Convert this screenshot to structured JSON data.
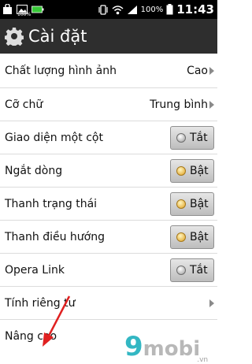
{
  "status_bar": {
    "battery_percent": "100%",
    "time": "11:43",
    "small_battery_label": "100%"
  },
  "action_bar": {
    "title": "Cài đặt",
    "icon": "gear-icon"
  },
  "settings": [
    {
      "label": "Chất lượng hình ảnh",
      "value": "Cao",
      "type": "select"
    },
    {
      "label": "Cỡ chữ",
      "value": "Trung bình",
      "type": "select"
    },
    {
      "label": "Giao diện một cột",
      "value": "Tắt",
      "type": "toggle",
      "state": "off"
    },
    {
      "label": "Ngắt dòng",
      "value": "Bật",
      "type": "toggle",
      "state": "on"
    },
    {
      "label": "Thanh trạng thái",
      "value": "Bật",
      "type": "toggle",
      "state": "on"
    },
    {
      "label": "Thanh điều hướng",
      "value": "Bật",
      "type": "toggle",
      "state": "on"
    },
    {
      "label": "Opera Link",
      "value": "Tắt",
      "type": "toggle",
      "state": "off"
    },
    {
      "label": "Tính riêng tư",
      "type": "link"
    },
    {
      "label": "Nâng cao",
      "type": "link"
    }
  ],
  "watermark": {
    "text_nine": "9",
    "text_mobi": "mobi",
    "text_domain": ".vn"
  },
  "colors": {
    "action_bar": "#2e2e2e",
    "toggle_on_led": "#e0a020",
    "annotation_arrow": "#e02020",
    "logo_accent": "#33b7c3"
  }
}
